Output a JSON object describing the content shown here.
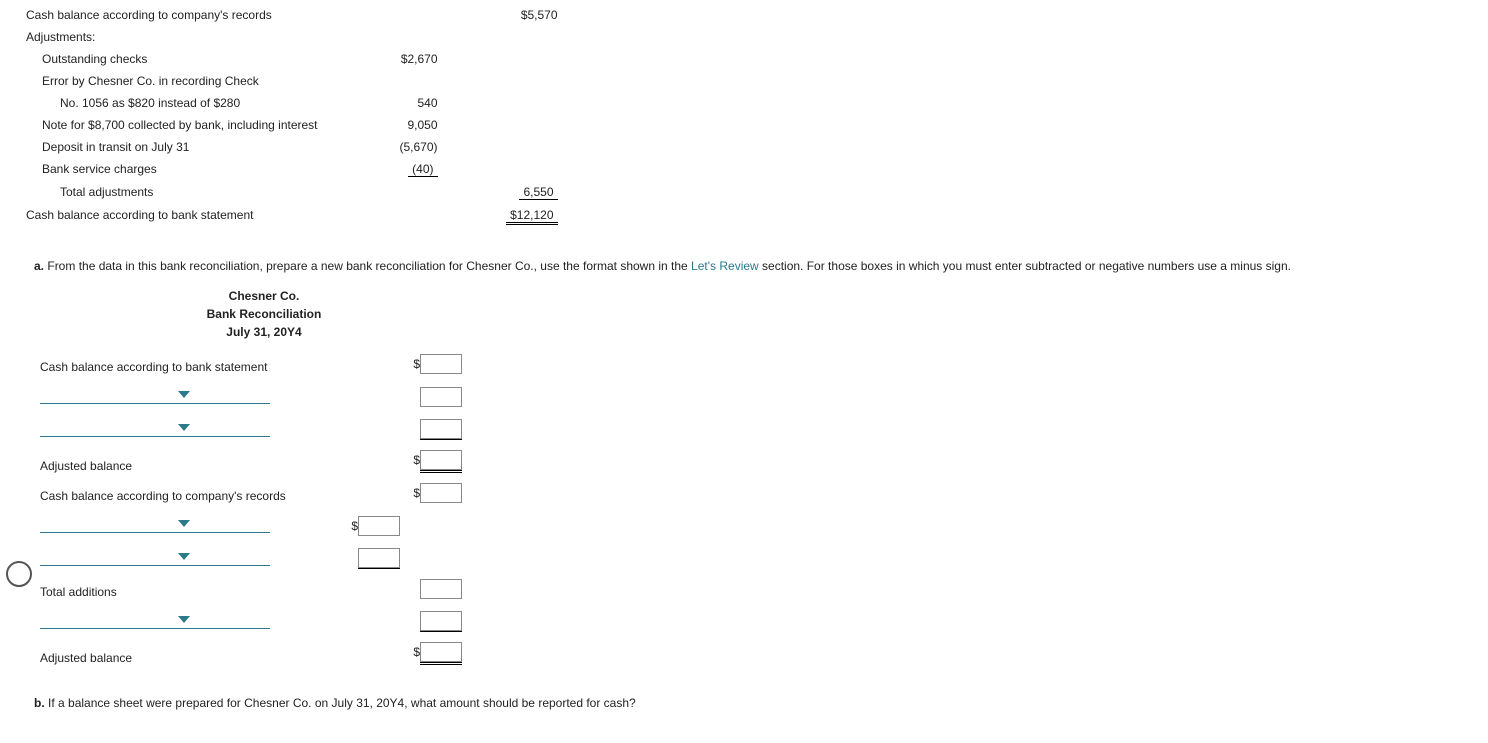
{
  "top": {
    "row1_label": "Cash balance according to company's records",
    "row1_val": "$5,570",
    "adjustments": "Adjustments:",
    "outstanding_checks": "Outstanding checks",
    "outstanding_checks_val": "$2,670",
    "error_line1": "Error by Chesner Co. in recording Check",
    "error_line2": "No. 1056 as $820 instead of $280",
    "error_val": "540",
    "note": "Note for $8,700 collected by bank, including interest",
    "note_val": "9,050",
    "deposit": "Deposit in transit on July 31",
    "deposit_val": "(5,670)",
    "svc": "Bank service charges",
    "svc_val": "(40)",
    "total_adj": "Total adjustments",
    "total_adj_val": "6,550",
    "bank_bal": "Cash balance according to bank statement",
    "bank_bal_val": "$12,120"
  },
  "qa": {
    "letter": "a.",
    "text1": "From the data in this bank reconciliation, prepare a new bank reconciliation for Chesner Co., use the format shown in the ",
    "link": "Let's Review",
    "text2": " section. For those boxes in which you must enter subtracted or negative numbers use a minus sign."
  },
  "hdr": {
    "l1": "Chesner Co.",
    "l2": "Bank Reconciliation",
    "l3": "July 31, 20Y4"
  },
  "form": {
    "cash_bank": "Cash balance according to bank statement",
    "adj_bal": "Adjusted balance",
    "cash_co": "Cash balance according to company's records",
    "tot_add": "Total additions",
    "adj_bal2": "Adjusted balance"
  },
  "qb": {
    "letter": "b.",
    "text": "If a balance sheet were prepared for Chesner Co. on July 31, 20Y4, what amount should be reported for cash?"
  }
}
